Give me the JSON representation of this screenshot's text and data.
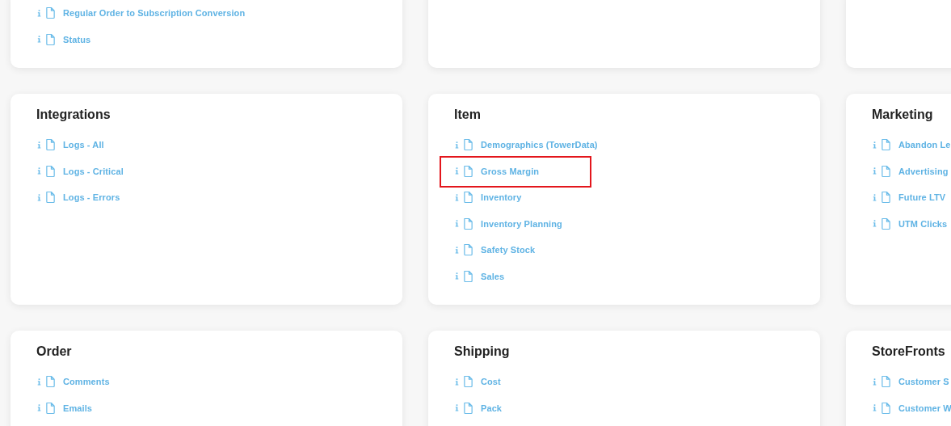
{
  "cards": [
    {
      "kind": "card",
      "items": [
        {
          "label": "Regular Order to Subscription Conversion",
          "highlighted": false
        },
        {
          "label": "Status",
          "highlighted": false
        }
      ]
    },
    {
      "kind": "card"
    },
    {
      "kind": "card"
    },
    {
      "kind": "card",
      "title": "Integrations",
      "items": [
        {
          "label": "Logs - All",
          "highlighted": false
        },
        {
          "label": "Logs - Critical",
          "highlighted": false
        },
        {
          "label": "Logs - Errors",
          "highlighted": false
        }
      ]
    },
    {
      "kind": "card",
      "title": "Item",
      "items": [
        {
          "label": "Demographics (TowerData)",
          "highlighted": false
        },
        {
          "label": "Gross Margin",
          "highlighted": true
        },
        {
          "label": "Inventory",
          "highlighted": false
        },
        {
          "label": "Inventory Planning",
          "highlighted": false
        },
        {
          "label": "Safety Stock",
          "highlighted": false
        },
        {
          "label": "Sales",
          "highlighted": false
        }
      ]
    },
    {
      "kind": "card",
      "title": "Marketing",
      "items": [
        {
          "label": "Abandon Le",
          "highlighted": false
        },
        {
          "label": "Advertising",
          "highlighted": false
        },
        {
          "label": "Future LTV",
          "highlighted": false
        },
        {
          "label": "UTM Clicks",
          "highlighted": false
        }
      ]
    },
    {
      "kind": "card",
      "title": "Order",
      "items": [
        {
          "label": "Comments",
          "highlighted": false
        },
        {
          "label": "Emails",
          "highlighted": false
        }
      ]
    },
    {
      "kind": "card",
      "title": "Shipping",
      "items": [
        {
          "label": "Cost",
          "highlighted": false
        },
        {
          "label": "Pack",
          "highlighted": false
        }
      ]
    },
    {
      "kind": "card",
      "title": "StoreFronts",
      "items": [
        {
          "label": "Customer S",
          "highlighted": false
        },
        {
          "label": "Customer W",
          "highlighted": false
        }
      ]
    }
  ]
}
